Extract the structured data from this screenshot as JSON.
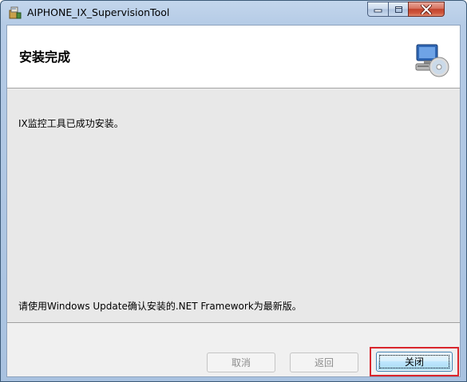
{
  "window": {
    "title": "AIPHONE_IX_SupervisionTool",
    "icons": {
      "app": "installer-package-icon",
      "minimize": "minimize-icon",
      "maximize": "maximize-icon",
      "close": "close-icon"
    }
  },
  "header": {
    "title": "安装完成",
    "icon": "computer-cd-icon"
  },
  "body": {
    "message": "IX监控工具已成功安装。",
    "note": "请使用Windows Update确认安装的.NET Framework为最新版。"
  },
  "footer": {
    "cancel_label": "取消",
    "back_label": "返回",
    "close_label": "关闭",
    "highlight_color": "#d9262c"
  }
}
